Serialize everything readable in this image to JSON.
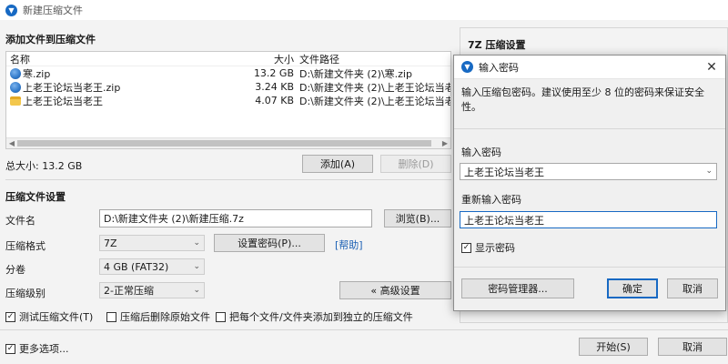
{
  "window": {
    "title": "新建压缩文件"
  },
  "add_section": {
    "title": "添加文件到压缩文件"
  },
  "file_list": {
    "headers": {
      "name": "名称",
      "size": "大小",
      "path": "文件路径"
    },
    "rows": [
      {
        "name": "寒.zip",
        "size": "13.2 GB",
        "path": "D:\\新建文件夹 (2)\\寒.zip",
        "icon": "zip-icon"
      },
      {
        "name": "上老王论坛当老王.zip",
        "size": "3.24 KB",
        "path": "D:\\新建文件夹 (2)\\上老王论坛当老王.zip",
        "icon": "zip-icon"
      },
      {
        "name": "上老王论坛当老王",
        "size": "4.07 KB",
        "path": "D:\\新建文件夹 (2)\\上老王论坛当老王",
        "icon": "folder-icon"
      }
    ]
  },
  "total_size": "总大小: 13.2 GB",
  "buttons": {
    "add": "添加(A)",
    "delete": "删除(D)",
    "browse": "浏览(B)...",
    "set_password": "设置密码(P)...",
    "advanced": "« 高级设置",
    "start": "开始(S)",
    "cancel": "取消"
  },
  "settings": {
    "title": "压缩文件设置",
    "filename_label": "文件名",
    "filename_value": "D:\\新建文件夹 (2)\\新建压缩.7z",
    "format_label": "压缩格式",
    "format_value": "7Z",
    "help_link": "[帮助]",
    "volume_label": "分卷",
    "volume_value": "4 GB (FAT32)",
    "level_label": "压缩级别",
    "level_value": "2-正常压缩"
  },
  "checkboxes": {
    "test": {
      "label": "测试压缩文件(T)",
      "checked": true
    },
    "delete_after": {
      "label": "压缩后删除原始文件",
      "checked": false
    },
    "separate": {
      "label": "把每个文件/文件夹添加到独立的压缩文件",
      "checked": false
    },
    "more_options": {
      "label": "更多选项...",
      "checked": true
    }
  },
  "right_panel": {
    "title": "7Z 压缩设置"
  },
  "password_dialog": {
    "title": "输入密码",
    "description": "输入压缩包密码。建议使用至少 8 位的密码来保证安全性。",
    "password_label": "输入密码",
    "password_value": "上老王论坛当老王",
    "reenter_label": "重新输入密码",
    "reenter_value": "上老王论坛当老王",
    "show_password": {
      "label": "显示密码",
      "checked": true
    },
    "manager_button": "密码管理器...",
    "ok_button": "确定",
    "cancel_button": "取消"
  },
  "colors": {
    "accent": "#1769c3",
    "link": "#1a5fb4"
  }
}
